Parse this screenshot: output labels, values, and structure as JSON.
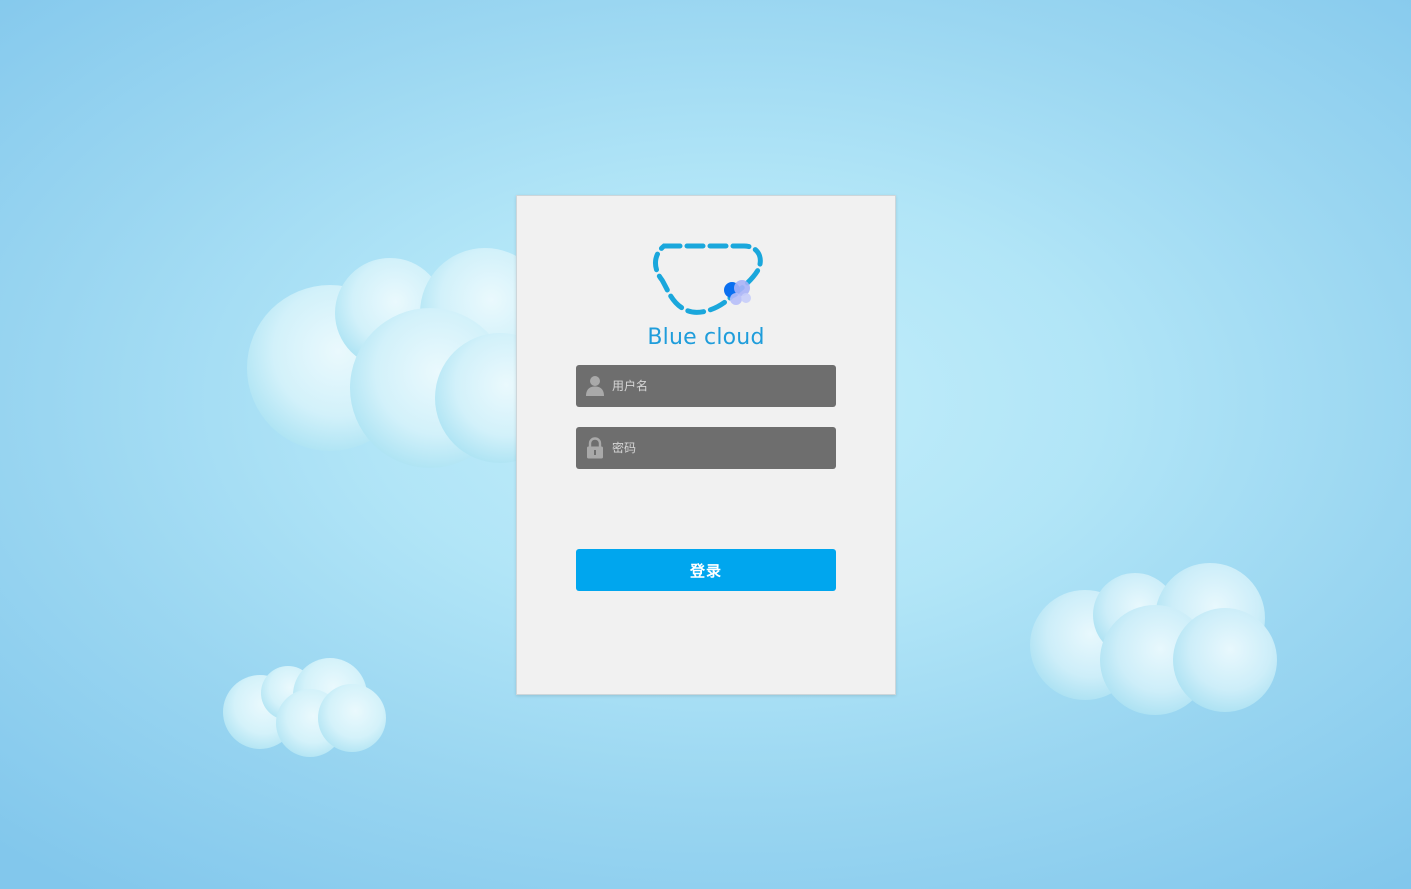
{
  "app": {
    "logo_text": "Blue cloud",
    "logo_icon": "dashed-cloud-logo-icon"
  },
  "form": {
    "username_placeholder": "用户名",
    "username_value": "",
    "username_icon": "user-icon",
    "password_placeholder": "密码",
    "password_value": "",
    "password_icon": "lock-icon",
    "submit_label": "登录"
  },
  "colors": {
    "background": "#a8def4",
    "card": "#f1f1f1",
    "input": "#6e6e6e",
    "accent": "#00a6ee",
    "logo_text": "#1f9ddb"
  }
}
